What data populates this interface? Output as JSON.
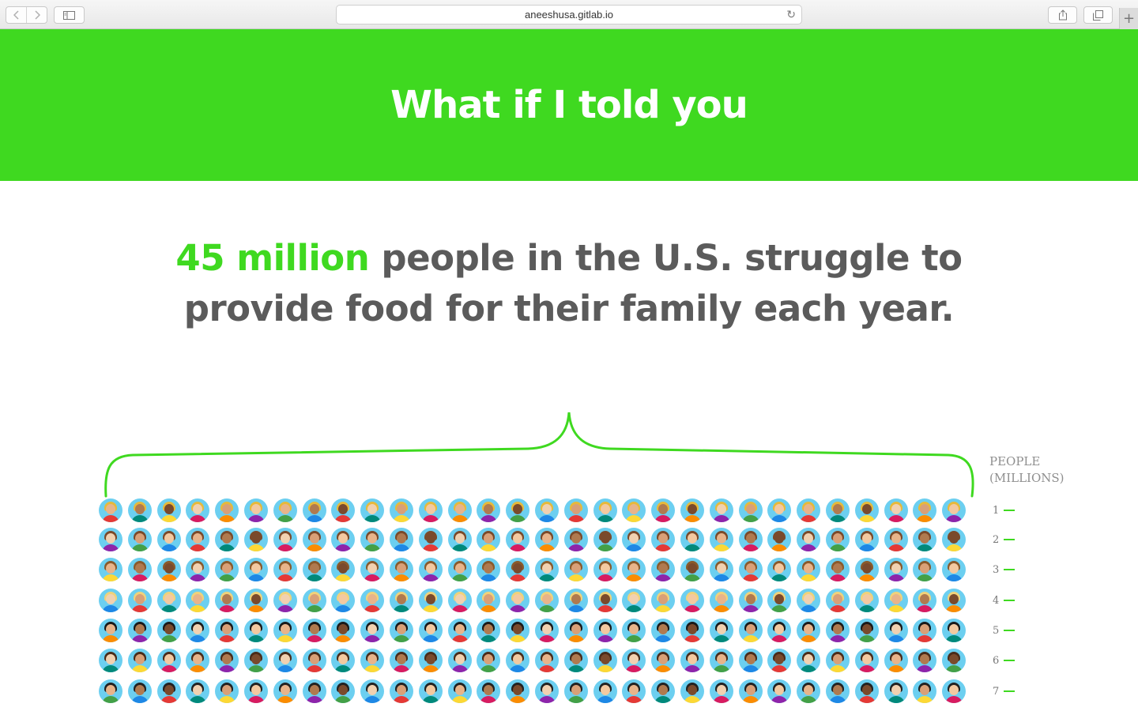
{
  "browser": {
    "url": "aneeshusa.gitlab.io",
    "back_icon": "chevron-left-icon",
    "forward_icon": "chevron-right-icon",
    "sidebar_icon": "sidebar-icon",
    "reload_icon": "reload-icon",
    "share_icon": "share-icon",
    "tabs_icon": "tabs-icon",
    "new_tab_icon": "plus-icon"
  },
  "hero": {
    "title": "What if I told you",
    "background": "#3fd920"
  },
  "statement": {
    "highlight": "45 million",
    "rest": " people in the U.S. struggle to provide food for their family each year."
  },
  "chart_data": {
    "type": "table",
    "ylabel": "PEOPLE (MILLIONS)",
    "accent": "#3fd920",
    "icons_per_row": 30,
    "rows": [
      1,
      2,
      3,
      4,
      5,
      6,
      7
    ]
  }
}
